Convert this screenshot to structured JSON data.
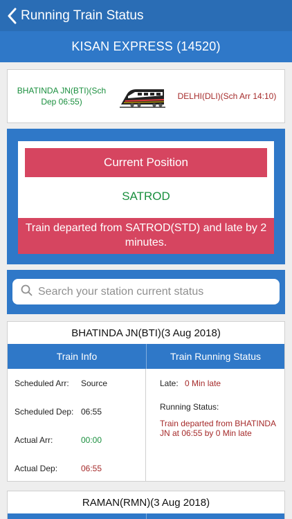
{
  "nav": {
    "title": "Running Train Status",
    "back_icon": "chevron-left-icon"
  },
  "train": {
    "name": "KISAN EXPRESS (14520)"
  },
  "route": {
    "from": "BHATINDA JN(BTI)(Sch Dep 06:55)",
    "to": "DELHI(DLI)(Sch Arr 14:10)",
    "icon": "train-icon"
  },
  "current_position": {
    "title": "Current Position",
    "station": "SATROD",
    "message": "Train departed from SATROD(STD) and late by 2 minutes."
  },
  "search": {
    "placeholder": "Search your station current status",
    "value": "",
    "icon": "search-icon"
  },
  "stations": [
    {
      "name": "BHATINDA JN(BTI)(3 Aug 2018)",
      "train_info_header": "Train Info",
      "running_status_header": "Train Running Status",
      "scheduled_arr_label": "Scheduled Arr:",
      "scheduled_arr": "Source",
      "scheduled_dep_label": "Scheduled Dep:",
      "scheduled_dep": "06:55",
      "actual_arr_label": "Actual Arr:",
      "actual_arr": "00:00",
      "actual_dep_label": "Actual Dep:",
      "actual_dep": "06:55",
      "late_label": "Late:",
      "late_value": "0 Min late",
      "running_status_label": "Running Status:",
      "running_status": "Train departed from BHATINDA JN at 06:55 by 0 Min late"
    },
    {
      "name": "RAMAN(RMN)(3 Aug 2018)"
    }
  ],
  "colors": {
    "primary": "#2a6db5",
    "panel_blue": "#2f78c8",
    "accent_red": "#d64560",
    "green_text": "#1a8f3e",
    "red_text": "#a52a2a"
  }
}
